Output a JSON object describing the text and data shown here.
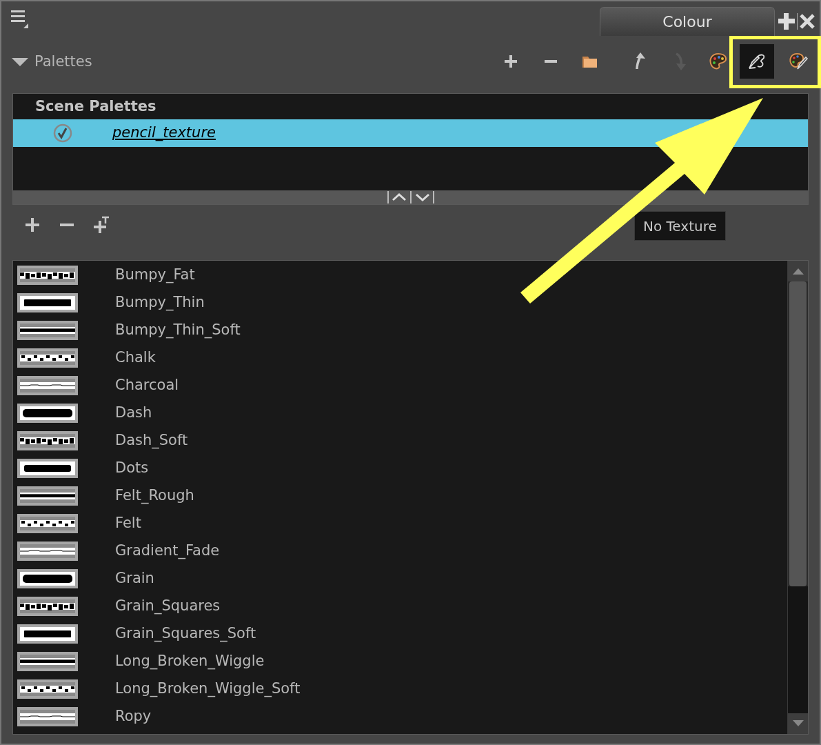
{
  "panel_tab": {
    "label": "Colour"
  },
  "palettes_section": {
    "label": "Palettes",
    "expanded": true
  },
  "toolbar": [
    {
      "kind": "add",
      "selected": false,
      "disabled": false
    },
    {
      "kind": "remove",
      "selected": false,
      "disabled": false
    },
    {
      "kind": "folder",
      "selected": false,
      "disabled": false
    },
    {
      "kind": "up",
      "selected": false,
      "disabled": false
    },
    {
      "kind": "down",
      "selected": false,
      "disabled": true
    },
    {
      "kind": "palette",
      "selected": false,
      "disabled": false
    },
    {
      "kind": "texture",
      "selected": true,
      "disabled": false
    },
    {
      "kind": "palette-texture",
      "selected": false,
      "disabled": false
    }
  ],
  "scene_palettes": {
    "header": "Scene Palettes",
    "items": [
      {
        "name": "pencil_texture",
        "checked": true,
        "selected": true
      }
    ]
  },
  "tooltip": "No Texture",
  "textures": [
    "Bumpy_Fat",
    "Bumpy_Thin",
    "Bumpy_Thin_Soft",
    "Chalk",
    "Charcoal",
    "Dash",
    "Dash_Soft",
    "Dots",
    "Felt_Rough",
    "Felt",
    "Gradient_Fade",
    "Grain",
    "Grain_Squares",
    "Grain_Squares_Soft",
    "Long_Broken_Wiggle",
    "Long_Broken_Wiggle_Soft",
    "Ropy"
  ]
}
